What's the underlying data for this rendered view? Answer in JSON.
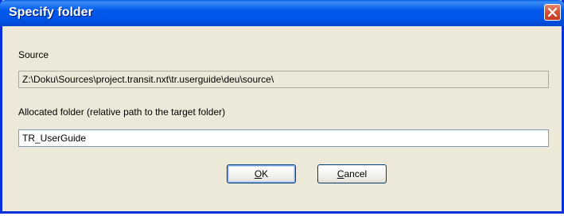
{
  "window": {
    "title": "Specify folder"
  },
  "source": {
    "label": "Source",
    "value": "Z:\\Doku\\Sources\\project.transit.nxt\\tr.userguide\\deu\\source\\"
  },
  "allocated": {
    "label": "Allocated folder (relative path to the target folder)",
    "value": "TR_UserGuide"
  },
  "buttons": {
    "ok_first": "O",
    "ok_rest": "K",
    "cancel_first": "C",
    "cancel_rest": "ancel"
  },
  "icons": {
    "close": "close-icon"
  },
  "colors": {
    "titlebar": "#0058ee",
    "close": "#d4533a",
    "dialog_bg": "#ece9d8"
  }
}
